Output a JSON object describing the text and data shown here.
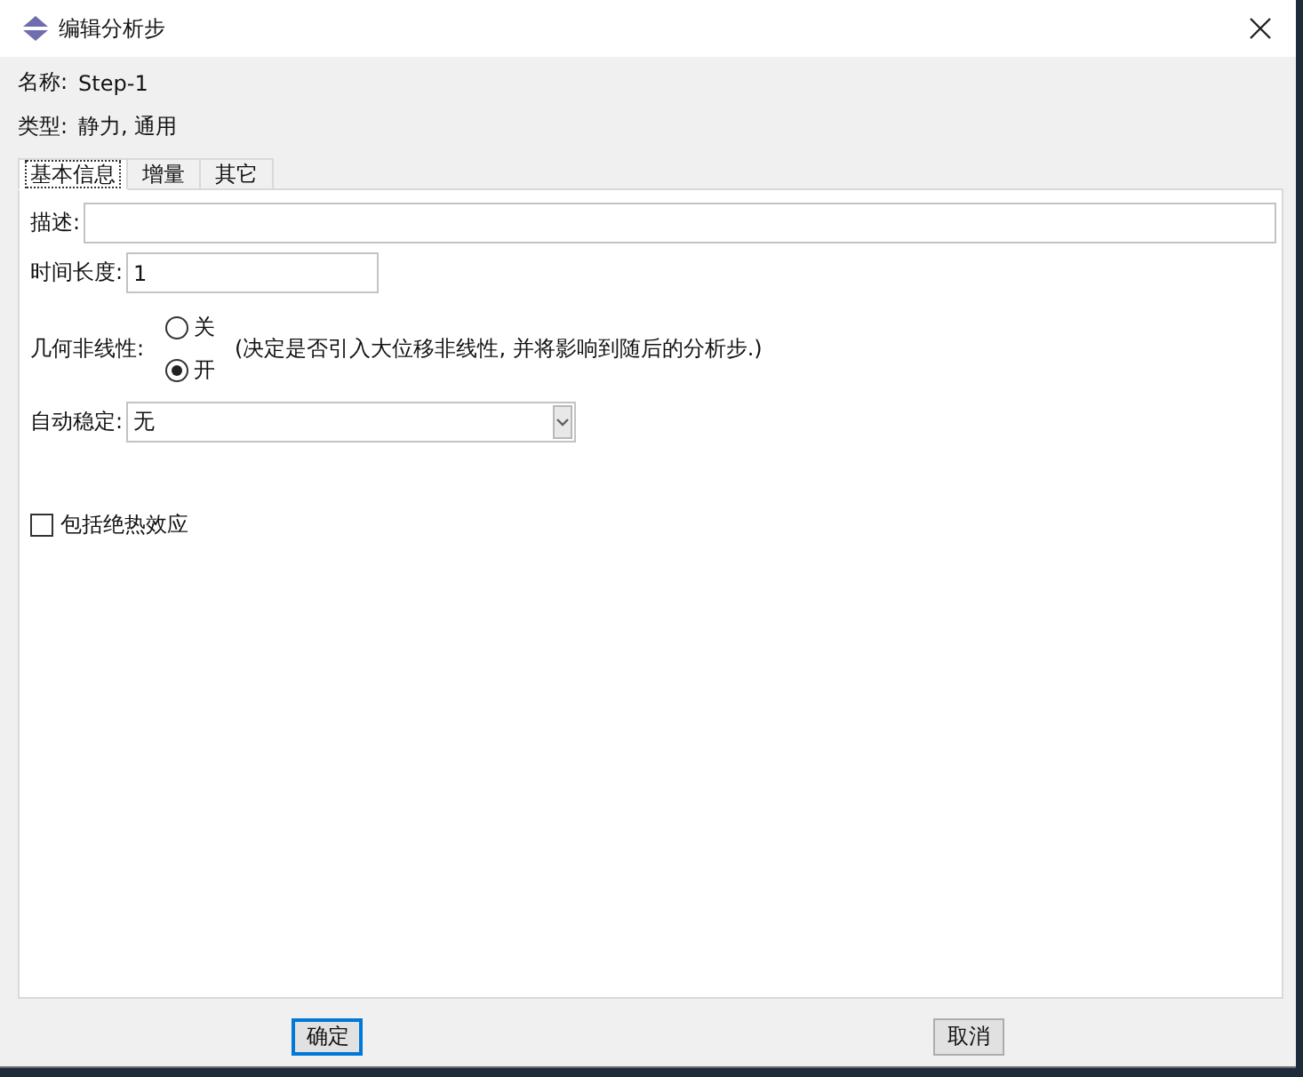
{
  "window": {
    "title": "编辑分析步"
  },
  "info": [
    {
      "label": "名称:",
      "value": "Step-1"
    },
    {
      "label": "类型:",
      "value": "静力, 通用"
    }
  ],
  "tabs": [
    {
      "label": "基本信息",
      "selected": true
    },
    {
      "label": "增量",
      "selected": false
    },
    {
      "label": "其它",
      "selected": false
    }
  ],
  "basic": {
    "description": {
      "label": "描述:"
    },
    "time_period": {
      "label": "时间长度:",
      "value": "1"
    },
    "nlgeom": {
      "label": "几何非线性:",
      "options": [
        {
          "label": "关",
          "selected": false
        },
        {
          "label": "开",
          "selected": true
        }
      ],
      "note": "(决定是否引入大位移非线性, 并将影响到随后的分析步.)"
    },
    "stabilization": {
      "label": "自动稳定:",
      "value": "无"
    },
    "adiabatic": {
      "label": "包括绝热效应",
      "checked": false
    }
  },
  "buttons": [
    {
      "label": "确定",
      "focused": true
    },
    {
      "label": "取消",
      "focused": false
    }
  ]
}
